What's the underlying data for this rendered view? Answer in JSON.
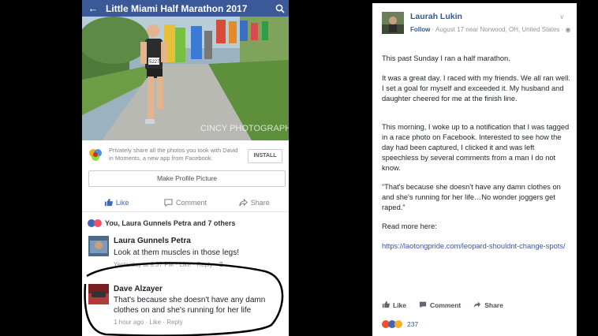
{
  "phone": {
    "header_title": "Little Miami Half Marathon 2017",
    "photo": {
      "watermark": "CINCY PHOTOGRAPHY",
      "bib": "5227"
    },
    "moments_text": "Privately share all the photos you took with David in Moments, a new app from Facebook.",
    "install_label": "INSTALL",
    "make_profile_label": "Make Profile Picture",
    "actions": {
      "like": "Like",
      "comment": "Comment",
      "share": "Share"
    },
    "reactions_text": "You, Laura Gunnels Petra and 7 others",
    "comments": [
      {
        "name": "Laura Gunnels Petra",
        "text": "Look at them muscles in those legs!",
        "time": "Yesterday at 9:37 PM",
        "like": "Like",
        "reply": "Reply",
        "reaction_count": "2"
      },
      {
        "name": "Dave Alzayer",
        "text": "That's because she doesn't have any damn clothes on and she's running for her life",
        "time": "1 hour ago",
        "like": "Like",
        "reply": "Reply"
      }
    ]
  },
  "post": {
    "author": "Laurah Lukin",
    "follow_label": "Follow",
    "meta": " · August 17 near Norwood, OH, United States · ",
    "paragraphs": [
      "This past Sunday I ran a half marathon.",
      "It was a great day. I raced with my friends. We all ran well. I set a goal for myself and exceeded it. My husband and daughter cheered for me at the finish line.",
      "This morning, I woke up to a notification that I was tagged in a race photo on Facebook. Interested to see how the day had been captured, I clicked it and was left speechless by several comments from a man I do not know.",
      "“That's because she doesn't have any damn clothes on and she's running for her life…No wonder joggers get raped.”",
      "Read more here:"
    ],
    "link": "https://laotongpride.com/leopard-shouldnt-change-spots/",
    "actions": {
      "like": "Like",
      "comment": "Comment",
      "share": "Share"
    },
    "reaction_count": "237"
  },
  "colors": {
    "facebook_blue": "#3b5998",
    "link_blue": "#365899",
    "annotation": "#000000"
  }
}
